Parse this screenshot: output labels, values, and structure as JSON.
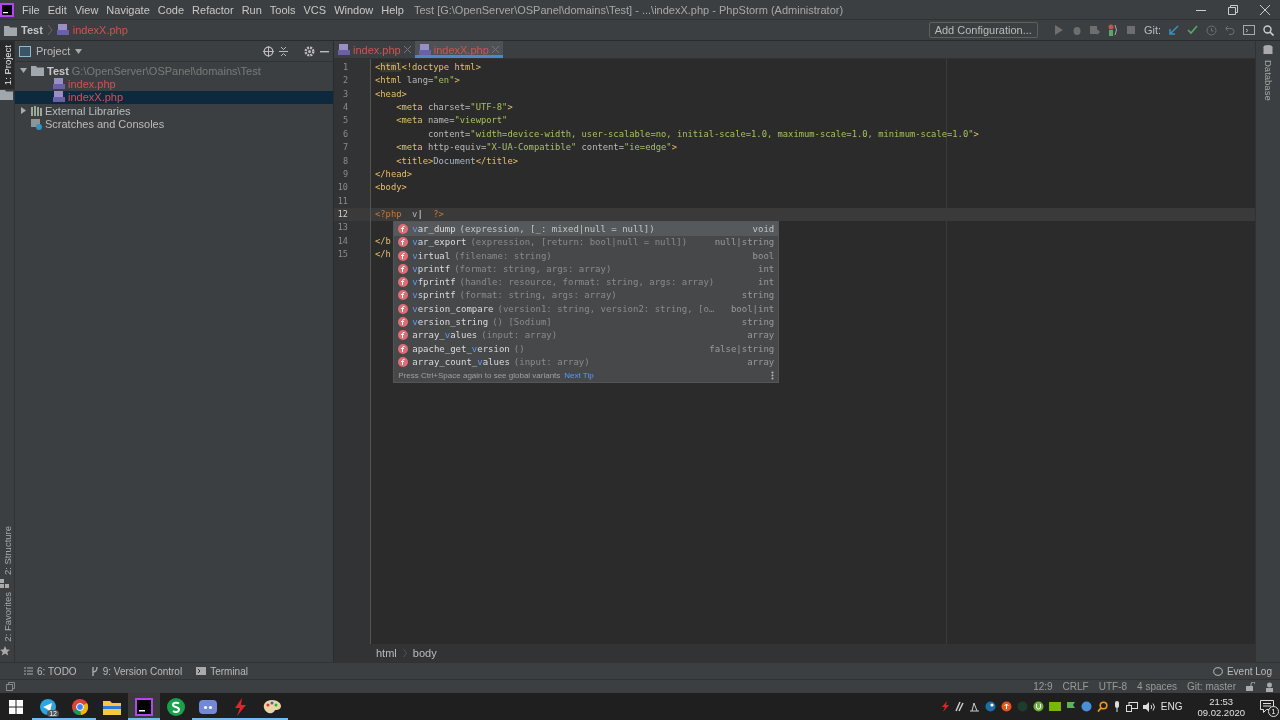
{
  "window": {
    "title": "Test [G:\\OpenServer\\OSPanel\\domains\\Test] - ...\\indexX.php - PhpStorm (Administrator)"
  },
  "menu": [
    "File",
    "Edit",
    "View",
    "Navigate",
    "Code",
    "Refactor",
    "Run",
    "Tools",
    "VCS",
    "Window",
    "Help"
  ],
  "navbar": {
    "project": "Test",
    "file": "indexX.php"
  },
  "toolbar": {
    "run_config": "Add Configuration...",
    "git_label": "Git:"
  },
  "left_stripe": [
    {
      "label": "1: Project",
      "kind": "project",
      "selected": true
    },
    {
      "label": "2: Structure",
      "kind": "structure",
      "selected": false
    },
    {
      "label": "2: Favorites",
      "kind": "favorites",
      "selected": false
    }
  ],
  "project_panel": {
    "title": "Project",
    "tree": [
      {
        "label": "Test",
        "path": "G:\\OpenServer\\OSPanel\\domains\\Test",
        "kind": "folder",
        "expanded": true,
        "selected": false,
        "children": [
          {
            "label": "index.php",
            "kind": "php",
            "selected": false
          },
          {
            "label": "indexX.php",
            "kind": "php",
            "selected": true
          }
        ]
      },
      {
        "label": "External Libraries",
        "kind": "library",
        "expanded": false,
        "selected": false
      },
      {
        "label": "Scratches and Consoles",
        "kind": "scratch",
        "selected": false
      }
    ]
  },
  "editor": {
    "tabs": [
      {
        "label": "index.php",
        "selected": false
      },
      {
        "label": "indexX.php",
        "selected": true
      }
    ],
    "lines": [
      {
        "number": "1",
        "current": false,
        "tokens": [
          {
            "kind": "tag",
            "text": "<"
          },
          {
            "kind": "match",
            "text": "html"
          },
          {
            "kind": "tag",
            "text": "<!doctype html>"
          }
        ]
      },
      {
        "number": "2",
        "current": false,
        "tokens": [
          {
            "kind": "tag",
            "text": "<html "
          },
          {
            "kind": "attr",
            "text": "lang="
          },
          {
            "kind": "str",
            "text": "\"en\""
          },
          {
            "kind": "tag",
            "text": ">"
          }
        ]
      },
      {
        "number": "3",
        "current": false,
        "tokens": [
          {
            "kind": "tag",
            "text": "<head>"
          }
        ]
      },
      {
        "number": "4",
        "current": false,
        "tokens": [
          {
            "kind": "tag",
            "text": "    <meta "
          },
          {
            "kind": "attr",
            "text": "charset="
          },
          {
            "kind": "str",
            "text": "\"UTF-8\""
          },
          {
            "kind": "tag",
            "text": ">"
          }
        ]
      },
      {
        "number": "5",
        "current": false,
        "tokens": [
          {
            "kind": "tag",
            "text": "    <meta "
          },
          {
            "kind": "attr",
            "text": "name="
          },
          {
            "kind": "str",
            "text": "\"viewport\""
          }
        ]
      },
      {
        "number": "6",
        "current": false,
        "tokens": [
          {
            "kind": "attr",
            "text": "          content="
          },
          {
            "kind": "str",
            "text": "\"width=device-width, user-scalable=no, initial-scale=1.0, maximum-scale=1.0, minimum-scale=1.0\""
          },
          {
            "kind": "tag",
            "text": ">"
          }
        ]
      },
      {
        "number": "7",
        "current": false,
        "tokens": [
          {
            "kind": "tag",
            "text": "    <meta "
          },
          {
            "kind": "attr",
            "text": "http-equiv="
          },
          {
            "kind": "str",
            "text": "\"X-UA-Compatible\" "
          },
          {
            "kind": "attr",
            "text": "content="
          },
          {
            "kind": "str",
            "text": "\"ie=edge\""
          },
          {
            "kind": "tag",
            "text": ">"
          }
        ]
      },
      {
        "number": "8",
        "current": false,
        "tokens": [
          {
            "kind": "tag",
            "text": "    <title>"
          },
          {
            "kind": "text",
            "text": "Document"
          },
          {
            "kind": "tag",
            "text": "</title>"
          }
        ]
      },
      {
        "number": "9",
        "current": false,
        "tokens": [
          {
            "kind": "tag",
            "text": "</head>"
          }
        ]
      },
      {
        "number": "10",
        "current": false,
        "tokens": [
          {
            "kind": "tag",
            "text": "<body>"
          }
        ]
      },
      {
        "number": "11",
        "current": false
      },
      {
        "number": "12",
        "current": true,
        "tokens": [
          {
            "kind": "php",
            "text": "<?php"
          },
          {
            "kind": "text",
            "text": "  v"
          },
          {
            "kind": "caret",
            "text": "|"
          },
          {
            "kind": "php",
            "text": "  ?>"
          }
        ]
      },
      {
        "number": "13",
        "current": false
      },
      {
        "number": "14",
        "current": false,
        "tokens": [
          {
            "kind": "tag",
            "text": "</b"
          }
        ]
      },
      {
        "number": "15",
        "current": false,
        "tokens": [
          {
            "kind": "tag",
            "text": "</h"
          }
        ]
      }
    ],
    "completion": {
      "items": [
        {
          "match": "v",
          "after": "ar_dump",
          "params": "(expression, [_: mixed|null = null])",
          "type": "void",
          "selected": true
        },
        {
          "match": "v",
          "after": "ar_export",
          "params": "(expression, [return: bool|null = null])",
          "type": "null|string",
          "selected": false
        },
        {
          "match": "v",
          "after": "irtual",
          "params": "(filename: string)",
          "type": "bool",
          "selected": false
        },
        {
          "match": "v",
          "after": "printf",
          "params": "(format: string, args: array)",
          "type": "int",
          "selected": false
        },
        {
          "match": "v",
          "after": "fprintf",
          "params": "(handle: resource, format: string, args: array)",
          "type": "int",
          "selected": false
        },
        {
          "match": "v",
          "after": "sprintf",
          "params": "(format: string, args: array)",
          "type": "string",
          "selected": false
        },
        {
          "match": "v",
          "after": "ersion_compare",
          "params": "(version1: string, version2: string, [o…",
          "type": "bool|int",
          "selected": false
        },
        {
          "match": "v",
          "after": "ersion_string",
          "params": "() [Sodium]",
          "type": "string",
          "selected": false
        },
        {
          "before": "array_",
          "match": "v",
          "after": "alues",
          "params": "(input: array)",
          "type": "array",
          "selected": false
        },
        {
          "before": "apache_get_",
          "match": "v",
          "after": "ersion",
          "params": "()",
          "type": "false|string",
          "selected": false
        },
        {
          "before": "array_count_",
          "match": "v",
          "after": "alues",
          "params": "(input: array)",
          "type": "array",
          "selected": false
        }
      ],
      "hint": "Press Ctrl+Space again to see global variants",
      "tip_link": "Next Tip"
    },
    "breadcrumbs": [
      "html",
      "body"
    ]
  },
  "right_stripe": [
    "Database"
  ],
  "tool_windows": [
    {
      "label": "6: TODO",
      "kind": "todo"
    },
    {
      "label": "9: Version Control",
      "kind": "vcs"
    },
    {
      "label": "Terminal",
      "kind": "terminal"
    }
  ],
  "event_log": "Event Log",
  "status_bar": [
    "12:9",
    "CRLF",
    "UTF-8",
    "4 spaces",
    "Git: master"
  ],
  "taskbar": {
    "apps": [
      {
        "kind": "telegram",
        "running": true,
        "selected": false,
        "badge": "12"
      },
      {
        "kind": "chrome",
        "running": true,
        "selected": false
      },
      {
        "kind": "explorer",
        "running": false,
        "selected": false
      },
      {
        "kind": "phpstorm",
        "running": true,
        "selected": true
      },
      {
        "kind": "sapp",
        "running": false,
        "selected": false
      },
      {
        "kind": "discord",
        "running": true,
        "selected": false
      },
      {
        "kind": "flash",
        "running": true,
        "selected": false
      },
      {
        "kind": "paint",
        "running": true,
        "selected": false
      }
    ],
    "language": "ENG",
    "time": "21:53",
    "date": "09.02.2020",
    "notification_count": "1"
  }
}
